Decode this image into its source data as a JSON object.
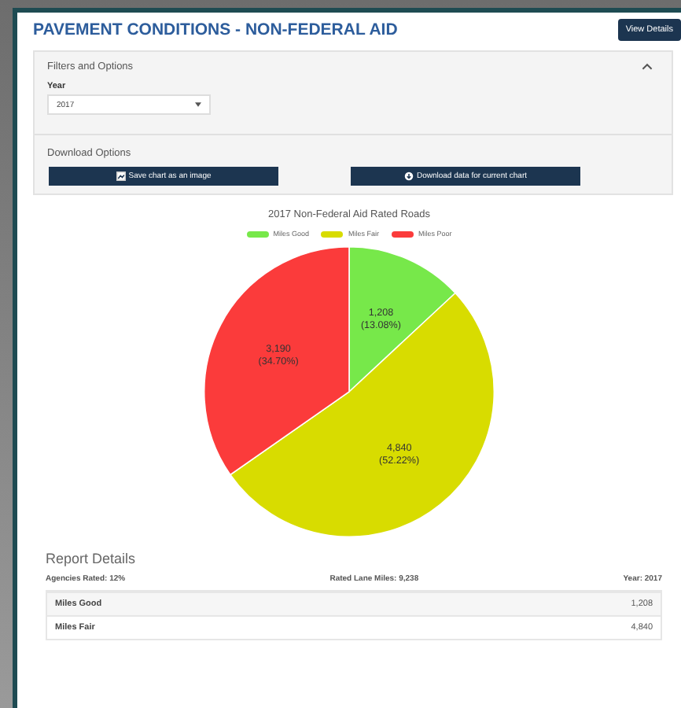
{
  "modal": {
    "title": "PAVEMENT CONDITIONS - NON-FEDERAL AID",
    "view_button": "View Details"
  },
  "filters": {
    "heading": "Filters and Options",
    "expanded": true,
    "year_label": "Year",
    "year_value": "2017"
  },
  "download": {
    "heading": "Download Options",
    "buttons": [
      {
        "kind": "image",
        "label": "Save chart as an image"
      },
      {
        "kind": "data",
        "label": "Download data for current chart"
      }
    ]
  },
  "chart_data": {
    "type": "pie",
    "title": "2017 Non-Federal Aid Rated Roads",
    "categories": [
      "Miles Good",
      "Miles Fair",
      "Miles Poor"
    ],
    "values": [
      13.08,
      52.22,
      34.7
    ],
    "colors": [
      "#77e84a",
      "#d8dc00",
      "#fb3b3b"
    ],
    "legend": true,
    "value_labels": [
      "1,208 (13.08%)",
      "4,840 (52.22%)",
      "3,190 (34.70%)"
    ]
  },
  "report": {
    "heading": "Report Details",
    "stats": [
      "Agencies Rated: 12%",
      "Rated Lane Miles: 9,238",
      "Year: 2017"
    ],
    "rows": [
      {
        "label": "Miles Good",
        "value": "1,208"
      },
      {
        "label": "Miles Fair",
        "value": "4,840"
      }
    ]
  }
}
